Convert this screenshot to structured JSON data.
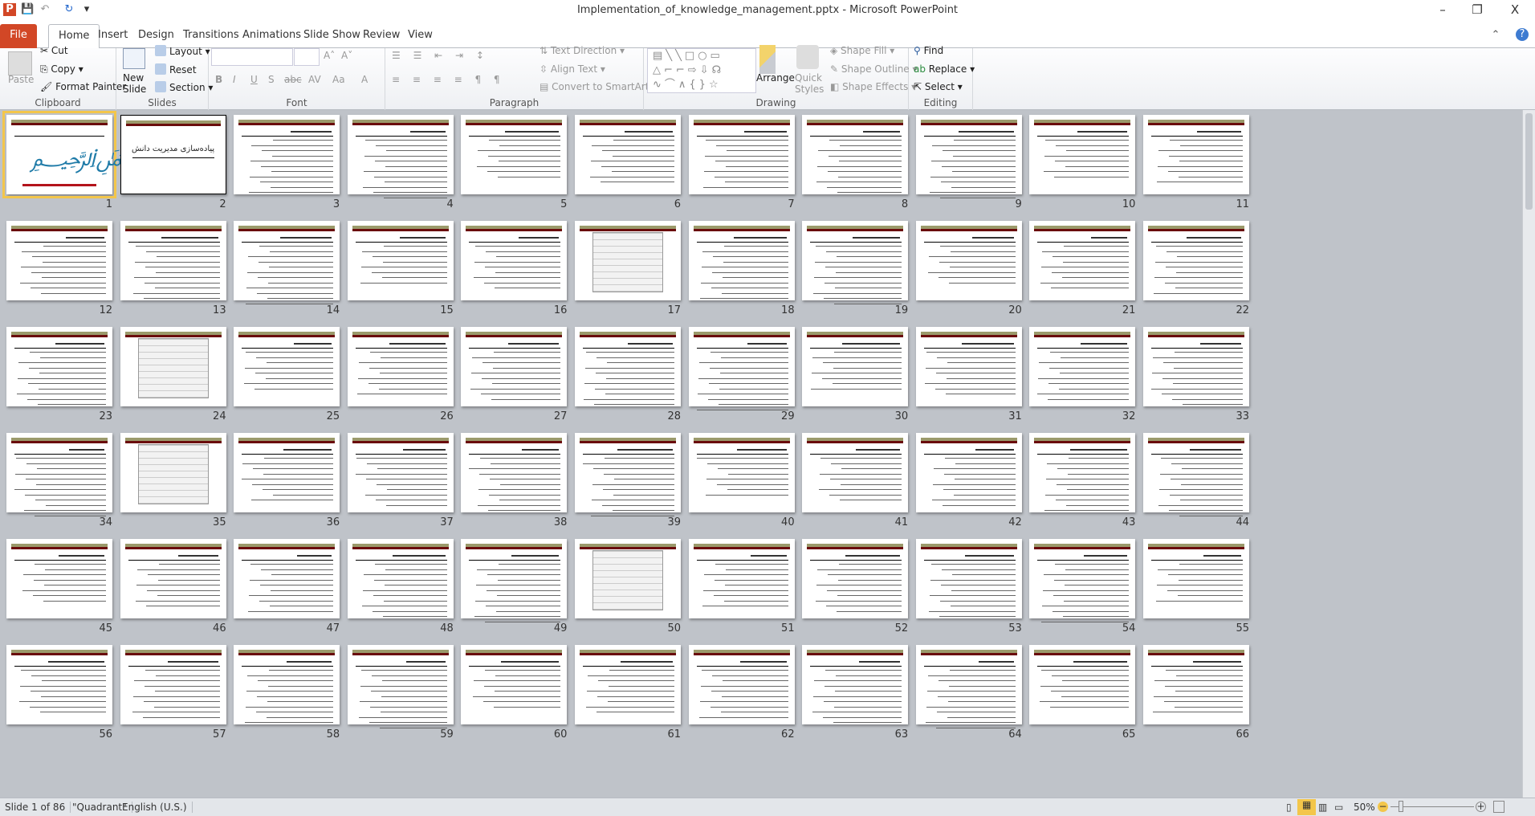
{
  "window": {
    "title": "Implementation_of_knowledge_management.pptx - Microsoft PowerPoint",
    "minimize": "–",
    "restore": "❐",
    "close": "X",
    "help": "?"
  },
  "tabs": [
    "File",
    "Home",
    "Insert",
    "Design",
    "Transitions",
    "Animations",
    "Slide Show",
    "Review",
    "View"
  ],
  "active_tab": "Home",
  "ribbon": {
    "clipboard": {
      "label": "Clipboard",
      "paste": "Paste",
      "cut": "Cut",
      "copy": "Copy",
      "format_painter": "Format Painter"
    },
    "slides": {
      "label": "Slides",
      "new_slide": "New Slide",
      "layout": "Layout",
      "reset": "Reset",
      "section": "Section"
    },
    "font": {
      "label": "Font",
      "font_name": "",
      "font_size": "",
      "bold": "B",
      "italic": "I",
      "underline": "U",
      "shadow": "S",
      "strike": "abc",
      "spacing": "AV",
      "case": "Aa",
      "color": "A"
    },
    "paragraph": {
      "label": "Paragraph",
      "text_direction": "Text Direction",
      "align_text": "Align Text",
      "convert_smartart": "Convert to SmartArt"
    },
    "drawing": {
      "label": "Drawing",
      "arrange": "Arrange",
      "quick_styles": "Quick Styles",
      "shape_fill": "Shape Fill",
      "shape_outline": "Shape Outline",
      "shape_effects": "Shape Effects"
    },
    "editing": {
      "label": "Editing",
      "find": "Find",
      "replace": "Replace",
      "select": "Select"
    }
  },
  "slides": {
    "first": 1,
    "visible_count": 66,
    "selected": 1,
    "slide2_title": "پیاده‌سازی مدیریت دانش"
  },
  "status": {
    "slide": "Slide 1 of 86",
    "theme": "\"Quadrant\"",
    "language": "English (U.S.)",
    "zoom": "50%",
    "zoom_value": 50
  },
  "colors": {
    "file_tab": "#d24726",
    "selection": "#f3c64b",
    "header_olive": "#9b9a6b",
    "header_red": "#6a0c0c"
  }
}
